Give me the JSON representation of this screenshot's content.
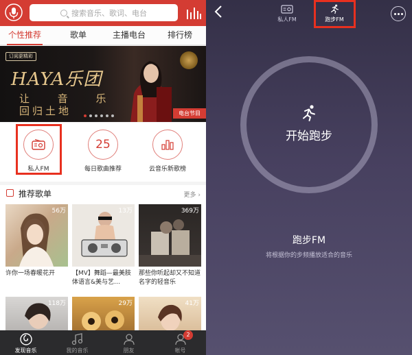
{
  "left": {
    "search_placeholder": "搜索音乐、歌词、电台",
    "tabs": [
      {
        "label": "个性推荐",
        "active": true
      },
      {
        "label": "歌单",
        "active": false
      },
      {
        "label": "主播电台",
        "active": false
      },
      {
        "label": "排行榜",
        "active": false
      }
    ],
    "banner": {
      "tag": "订阅更精彩",
      "title": "HAYA乐团",
      "line1": "让 音 乐",
      "line2": "回归土地",
      "badge": "电台节目"
    },
    "quick": [
      {
        "label": "私人FM",
        "icon": "radio-icon"
      },
      {
        "label": "每日歌曲推荐",
        "icon": "calendar-icon",
        "value": "25"
      },
      {
        "label": "云音乐新歌榜",
        "icon": "chart-icon"
      }
    ],
    "section": {
      "title": "推荐歌单",
      "more": "更多 ›"
    },
    "cards": [
      {
        "plays": "56万",
        "text": "许你一场春暖花开"
      },
      {
        "plays": "13万",
        "text": "【MV】舞蹈—最美肢体语言&美与艺…"
      },
      {
        "plays": "369万",
        "text": "那些你听起却又不知道名字的轻音乐"
      },
      {
        "plays": "118万",
        "text": ""
      },
      {
        "plays": "29万",
        "text": ""
      },
      {
        "plays": "41万",
        "text": ""
      }
    ],
    "nav": [
      {
        "label": "发现音乐",
        "active": true
      },
      {
        "label": "我的音乐",
        "active": false
      },
      {
        "label": "朋友",
        "active": false
      },
      {
        "label": "帐号",
        "active": false,
        "badge": "2"
      }
    ]
  },
  "right": {
    "top_tabs": [
      {
        "label": "私人FM",
        "active": false
      },
      {
        "label": "跑步FM",
        "active": true
      }
    ],
    "start_label": "开始跑步",
    "fm_title": "跑步FM",
    "fm_desc": "将根据你的步频播放适合的音乐"
  }
}
